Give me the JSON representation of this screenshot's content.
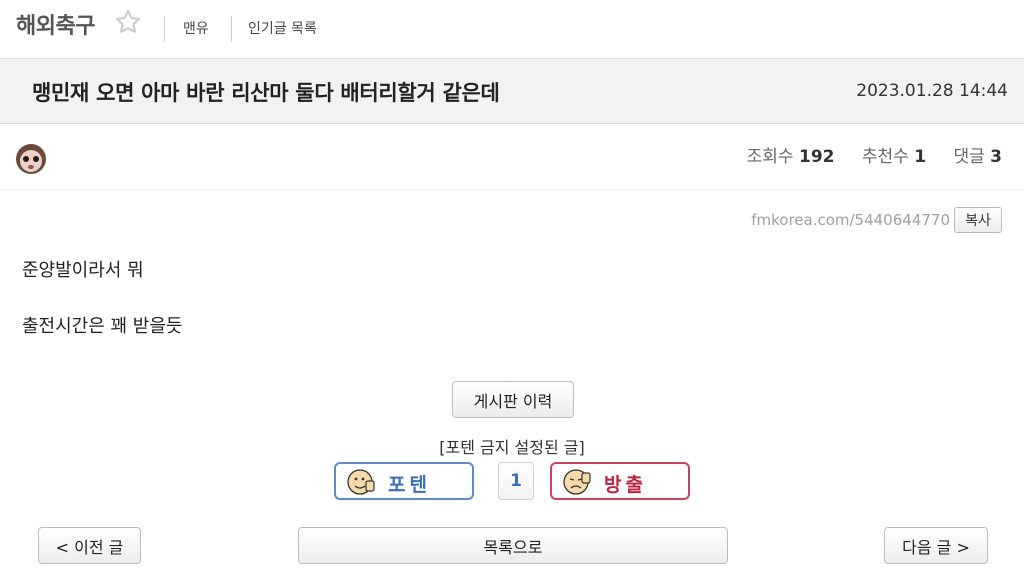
{
  "board": {
    "name": "해외축구",
    "star_icon": "star-outline-icon"
  },
  "nav": {
    "links": [
      "맨유",
      "인기글 목록"
    ]
  },
  "post": {
    "title": "맹민재 오면 아마 바란 리산마 둘다 배터리할거 같은데",
    "date": "2023.01.28 14:44",
    "stats": {
      "views_label": "조회수",
      "views": "192",
      "recommend_label": "추천수",
      "recommend": "1",
      "comments_label": "댓글",
      "comments": "3"
    },
    "url": "fmkorea.com/5440644770",
    "copy_label": "복사",
    "content": [
      "준양발이라서 뭐",
      "출전시간은 꽤 받을듯"
    ]
  },
  "actions": {
    "history_label": "게시판 이력",
    "ban_notice": "[포텐 금지 설정된 글]",
    "vote_up_label": "포텐",
    "vote_count": "1",
    "vote_down_label": "방출",
    "prev_label": "< 이전 글",
    "list_label": "목록으로",
    "next_label": "다음 글 >"
  },
  "colors": {
    "vote_up": "#5f8bc9",
    "vote_down": "#c9435f",
    "title_bar_bg": "#f2f2f2"
  }
}
